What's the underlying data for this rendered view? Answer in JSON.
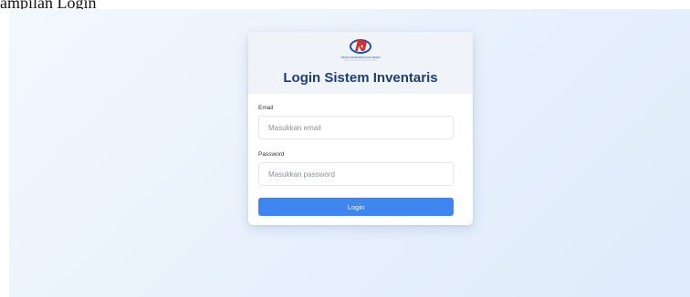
{
  "caption": "ampilan Login",
  "login_card": {
    "logo": {
      "icon": "institution-logo",
      "tagline": "TEKNIK INFORMATIKA POLITEKNIK"
    },
    "title": "Login Sistem Inventaris",
    "email": {
      "label": "Email",
      "value": "",
      "placeholder": "Masukkan email"
    },
    "password": {
      "label": "Password",
      "value": "",
      "placeholder": "Masukkan password"
    },
    "submit_label": "Login"
  },
  "colors": {
    "accent": "#3f84f0",
    "title": "#1f3c78",
    "logo_red": "#d32f2f",
    "logo_blue": "#1f4fa8",
    "background": "#e5effb"
  }
}
